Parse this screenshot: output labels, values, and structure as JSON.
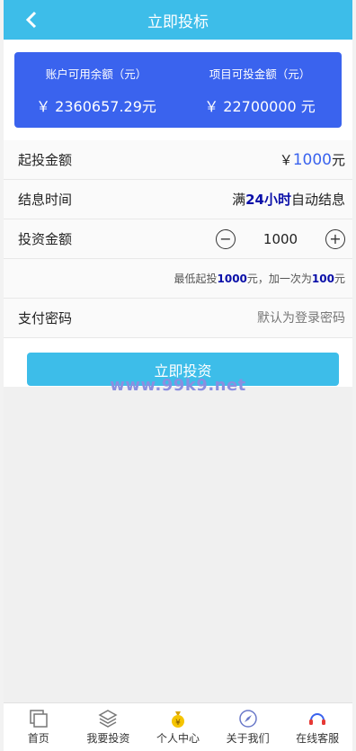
{
  "header": {
    "title": "立即投标"
  },
  "balance": {
    "available_label": "账户可用余额（元）",
    "available_value": "￥ 2360657.29元",
    "project_label": "项目可投金额（元）",
    "project_value": "￥ 22700000 元"
  },
  "min_invest": {
    "label": "起投金额",
    "currency": "￥ ",
    "amount": "1000",
    "unit": " 元"
  },
  "interest_time": {
    "label": "结息时间",
    "prefix": "满 ",
    "period": "24小时",
    "suffix": " 自动结息"
  },
  "invest_amount": {
    "label": "投资金额",
    "value": "1000",
    "minus": "−",
    "plus": "+"
  },
  "hint": {
    "p1": "最低起投 ",
    "min": "1000",
    "p2": " 元，加一次为 ",
    "step": "100",
    "p3": " 元"
  },
  "password": {
    "label": "支付密码",
    "placeholder": "默认为登录密码"
  },
  "submit": {
    "label": "立即投资"
  },
  "watermark": "www.99k9.net",
  "tabbar": {
    "items": [
      {
        "label": "首页",
        "icon": "home-icon"
      },
      {
        "label": "我要投资",
        "icon": "layers-icon"
      },
      {
        "label": "个人中心",
        "icon": "money-bag-icon"
      },
      {
        "label": "关于我们",
        "icon": "compass-icon"
      },
      {
        "label": "在线客服",
        "icon": "headset-icon"
      }
    ]
  },
  "colors": {
    "header": "#3dbde9",
    "card": "#3a63ee",
    "highlight": "#0a0fa8"
  }
}
